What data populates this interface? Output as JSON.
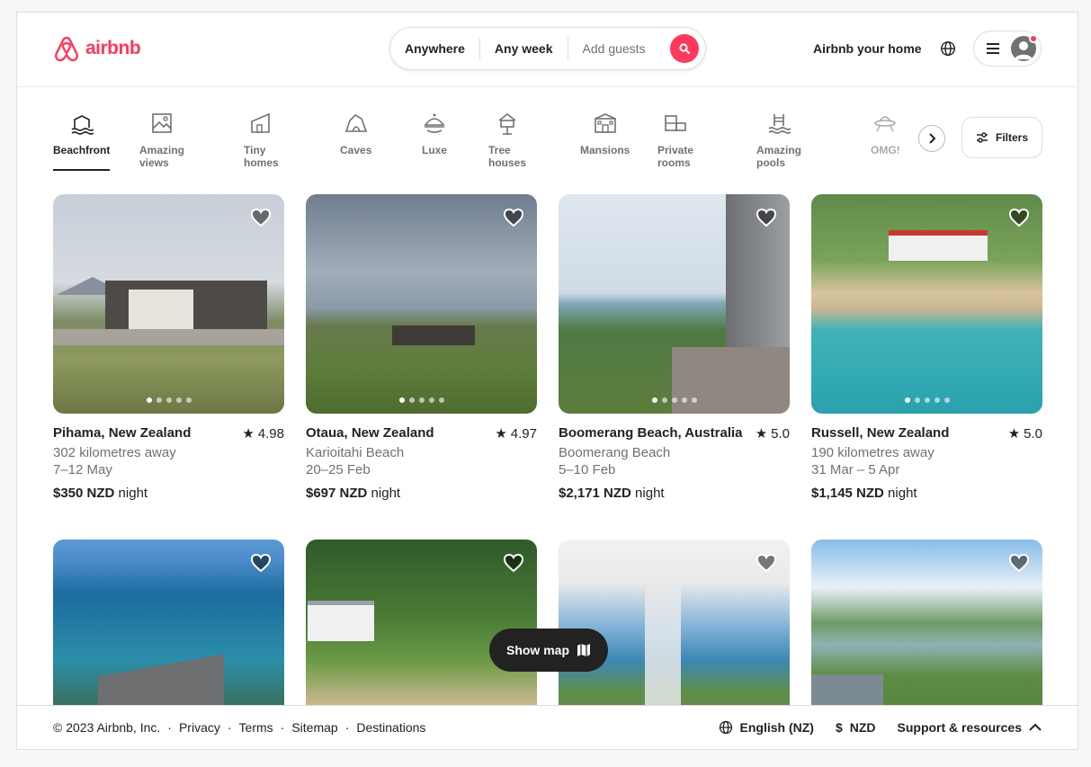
{
  "header": {
    "brand": "airbnb",
    "search": {
      "location": "Anywhere",
      "dates": "Any week",
      "guests": "Add guests"
    },
    "host_link": "Airbnb your home"
  },
  "categories": [
    {
      "label": "Beachfront",
      "icon": "beachfront-icon",
      "active": true
    },
    {
      "label": "Amazing views",
      "icon": "views-icon"
    },
    {
      "label": "Tiny homes",
      "icon": "tiny-home-icon"
    },
    {
      "label": "Caves",
      "icon": "cave-icon"
    },
    {
      "label": "Luxe",
      "icon": "luxe-icon"
    },
    {
      "label": "Tree houses",
      "icon": "treehouse-icon"
    },
    {
      "label": "Mansions",
      "icon": "mansion-icon"
    },
    {
      "label": "Private rooms",
      "icon": "private-room-icon"
    },
    {
      "label": "Amazing pools",
      "icon": "pool-icon"
    },
    {
      "label": "OMG!",
      "icon": "ufo-icon"
    }
  ],
  "filters_label": "Filters",
  "listings": [
    {
      "title": "Pihama, New Zealand",
      "rating": "4.98",
      "line1": "302 kilometres away",
      "line2": "7–12 May",
      "price": "$350 NZD",
      "unit": "night"
    },
    {
      "title": "Otaua, New Zealand",
      "rating": "4.97",
      "line1": "Karioitahi Beach",
      "line2": "20–25 Feb",
      "price": "$697 NZD",
      "unit": "night"
    },
    {
      "title": "Boomerang Beach, Australia",
      "rating": "5.0",
      "line1": "Boomerang Beach",
      "line2": "5–10 Feb",
      "price": "$2,171 NZD",
      "unit": "night"
    },
    {
      "title": "Russell, New Zealand",
      "rating": "5.0",
      "line1": "190 kilometres away",
      "line2": "31 Mar – 5 Apr",
      "price": "$1,145 NZD",
      "unit": "night"
    }
  ],
  "show_map": "Show map",
  "footer": {
    "copyright": "© 2023 Airbnb, Inc.",
    "links": [
      "Privacy",
      "Terms",
      "Sitemap",
      "Destinations"
    ],
    "language": "English (NZ)",
    "currency_symbol": "$",
    "currency": "NZD",
    "support": "Support & resources"
  },
  "colors": {
    "brand": "#ff385c",
    "text": "#222222",
    "muted": "#717171"
  }
}
